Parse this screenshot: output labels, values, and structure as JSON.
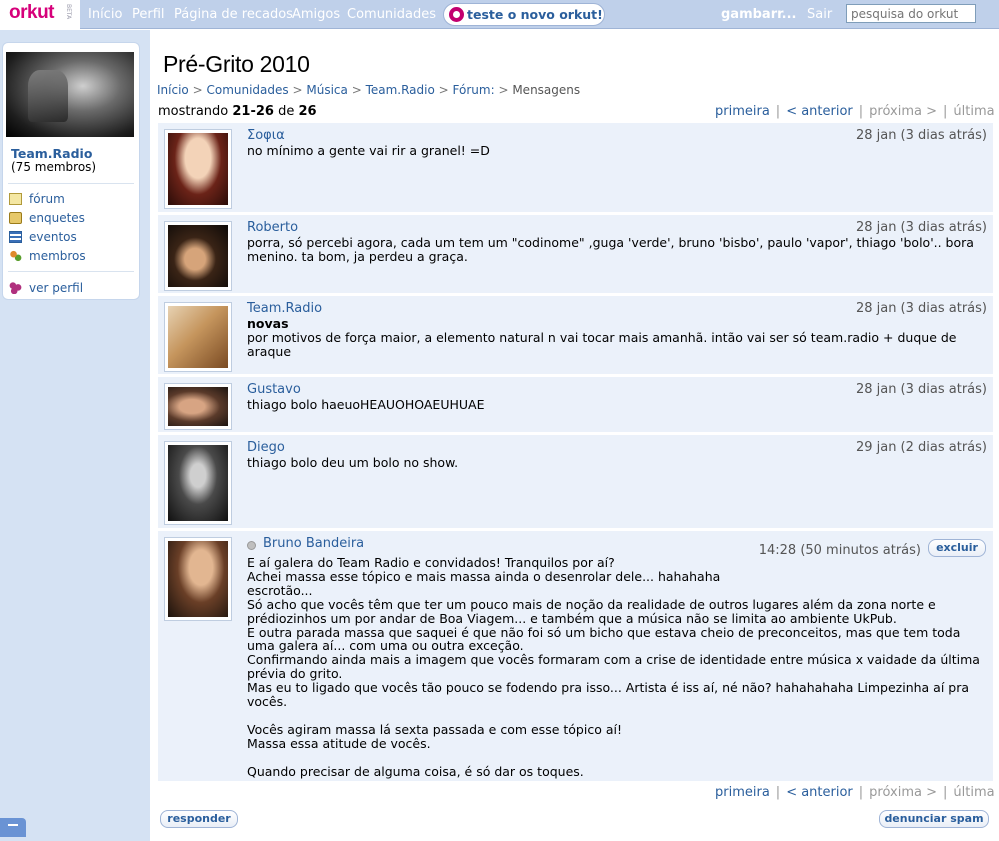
{
  "topbar": {
    "logo_text": "orkut",
    "logo_badge": "BETA",
    "nav": [
      "Início",
      "Perfil",
      "Página de recados",
      "Amigos",
      "Comunidades"
    ],
    "try_new": "teste o novo orkut!",
    "user": "gambarr...",
    "logout": "Sair",
    "search_placeholder": "pesquisa do orkut"
  },
  "sidebar": {
    "community_name": "Team.Radio",
    "member_count": "(75 membros)",
    "items": [
      {
        "label": "fórum",
        "icon": "forum-icon"
      },
      {
        "label": "enquetes",
        "icon": "poll-icon"
      },
      {
        "label": "eventos",
        "icon": "calendar-icon"
      },
      {
        "label": "membros",
        "icon": "members-icon"
      }
    ],
    "profile_link": "ver perfil"
  },
  "page": {
    "title": "Pré-Grito 2010",
    "breadcrumb": [
      "Início",
      "Comunidades",
      "Música",
      "Team.Radio",
      "Fórum:",
      "Mensagens"
    ],
    "showing_label": "mostrando",
    "showing_range": "21-26",
    "showing_of": "de",
    "showing_total": "26"
  },
  "pager": {
    "first": "primeira",
    "prev": "< anterior",
    "next": "próxima >",
    "last": "última"
  },
  "posts": [
    {
      "author": "Σοφια",
      "date": "28 jan (3 dias atrás)",
      "subject": "",
      "body": "no mínimo a gente vai rir a granel! =D"
    },
    {
      "author": "Roberto",
      "date": "28 jan (3 dias atrás)",
      "subject": "",
      "body": "porra, só percebi agora, cada um tem um \"codinome\" ,guga 'verde', bruno 'bisbo', paulo 'vapor', thiago 'bolo'.. bora menino. ta bom, ja perdeu a graça."
    },
    {
      "author": "Team.Radio",
      "date": "28 jan (3 dias atrás)",
      "subject": "novas",
      "body": "por motivos de força maior, a elemento natural n vai tocar mais amanhã. intão vai ser só team.radio + duque de araque"
    },
    {
      "author": "Gustavo",
      "date": "28 jan (3 dias atrás)",
      "subject": "",
      "body": "thiago bolo haeuoHEAUOHOAEUHUAE"
    },
    {
      "author": "Diego",
      "date": "29 jan (2 dias atrás)",
      "subject": "",
      "body": "thiago bolo deu um bolo no show."
    },
    {
      "author": "Bruno Bandeira",
      "date": "14:28 (50 minutos atrás)",
      "subject": "",
      "delete_label": "excluir",
      "body": "E aí galera do Team Radio e convidados! Tranquilos por aí?\nAchei massa esse tópico e mais massa ainda o desenrolar dele... hahahaha\nescrotão...\nSó acho que vocês têm que ter um pouco mais de noção da realidade de outros lugares além da zona norte e\nprédiozinhos um por andar de Boa Viagem... e também que a música não se limita ao ambiente UkPub.\nE outra parada massa que saquei é que não foi só um bicho que estava cheio de preconceitos, mas que tem toda\numa galera aí... com uma ou outra exceção.\nConfirmando ainda mais a imagem que vocês formaram com a crise de identidade entre música x vaidade da última\nprévia do grito.\nMas eu to ligado que vocês tão pouco se fodendo pra isso... Artista é iss aí, né não? hahahahaha Limpezinha aí pra\nvocês.\n\nVocês agiram massa lá sexta passada e com esse tópico aí!\nMassa essa atitude de vocês.\n\nQuando precisar de alguma coisa, é só dar os toques."
    }
  ],
  "actions": {
    "reply": "responder",
    "report_spam": "denunciar spam"
  }
}
